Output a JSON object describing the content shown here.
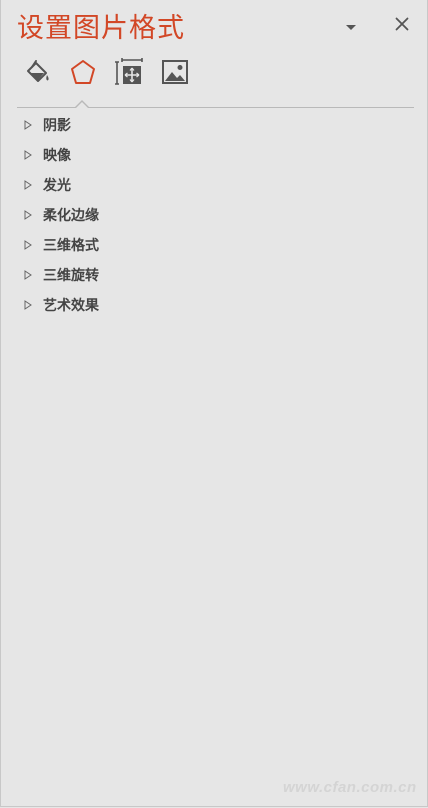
{
  "pane": {
    "title": "设置图片格式",
    "accent_color": "#d24726",
    "options_icon": "chevron-down-icon",
    "close_icon": "close-icon"
  },
  "tabs": [
    {
      "id": "fill-line",
      "icon": "paint-bucket-icon",
      "selected": false
    },
    {
      "id": "effects",
      "icon": "pentagon-icon",
      "selected": true
    },
    {
      "id": "size-properties",
      "icon": "size-properties-icon",
      "selected": false
    },
    {
      "id": "picture",
      "icon": "picture-icon",
      "selected": false
    }
  ],
  "sections": [
    {
      "label": "阴影",
      "expanded": false
    },
    {
      "label": "映像",
      "expanded": false
    },
    {
      "label": "发光",
      "expanded": false
    },
    {
      "label": "柔化边缘",
      "expanded": false
    },
    {
      "label": "三维格式",
      "expanded": false
    },
    {
      "label": "三维旋转",
      "expanded": false
    },
    {
      "label": "艺术效果",
      "expanded": false
    }
  ],
  "watermark": "www.cfan.com.cn"
}
